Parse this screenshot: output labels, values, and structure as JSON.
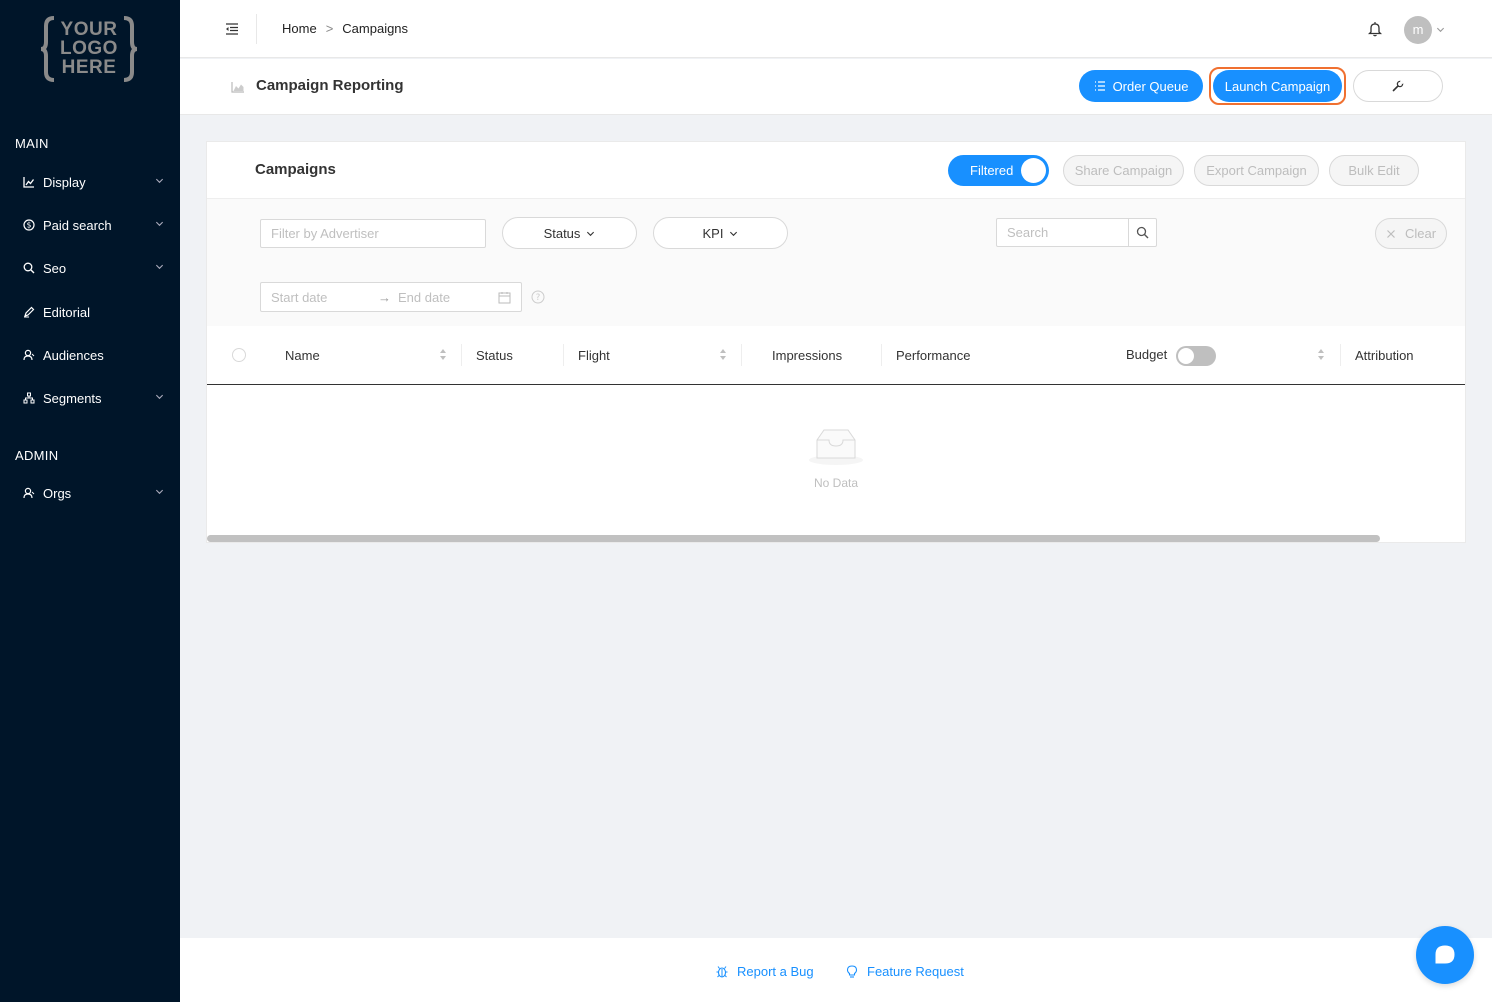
{
  "sidebar": {
    "logo_lines": [
      "YOUR",
      "LOGO",
      "HERE"
    ],
    "sections": [
      {
        "label": "MAIN"
      },
      {
        "label": "ADMIN"
      }
    ],
    "items": [
      {
        "label": "Display",
        "icon": "chart-icon",
        "expandable": true
      },
      {
        "label": "Paid search",
        "icon": "dollar-icon",
        "expandable": true
      },
      {
        "label": "Seo",
        "icon": "search-icon",
        "expandable": true
      },
      {
        "label": "Editorial",
        "icon": "pen-icon",
        "expandable": false
      },
      {
        "label": "Audiences",
        "icon": "user-icon",
        "expandable": false
      },
      {
        "label": "Segments",
        "icon": "cluster-icon",
        "expandable": true
      },
      {
        "label": "Orgs",
        "icon": "user-icon",
        "expandable": true
      }
    ]
  },
  "header": {
    "breadcrumb": [
      "Home",
      "Campaigns"
    ],
    "breadcrumb_sep": ">",
    "avatar_initial": "m"
  },
  "page": {
    "title": "Campaign Reporting",
    "order_queue_label": "Order Queue",
    "launch_label": "Launch Campaign"
  },
  "card": {
    "title": "Campaigns",
    "filtered_label": "Filtered",
    "share_label": "Share Campaign",
    "export_label": "Export Campaign",
    "bulk_edit_label": "Bulk Edit"
  },
  "filters": {
    "advertiser_placeholder": "Filter by Advertiser",
    "status_label": "Status",
    "kpi_label": "KPI",
    "search_placeholder": "Search",
    "clear_label": "Clear",
    "start_date_placeholder": "Start date",
    "end_date_placeholder": "End date",
    "range_arrow": "→"
  },
  "table": {
    "columns": {
      "name": "Name",
      "status": "Status",
      "flight": "Flight",
      "impressions": "Impressions",
      "performance": "Performance",
      "budget": "Budget",
      "attribution": "Attribution"
    },
    "empty_text": "No Data"
  },
  "footer": {
    "report_bug": "Report a Bug",
    "feature_request": "Feature Request"
  },
  "colors": {
    "sidebar_bg": "#001529",
    "primary": "#1890ff",
    "highlight": "#f07030"
  }
}
